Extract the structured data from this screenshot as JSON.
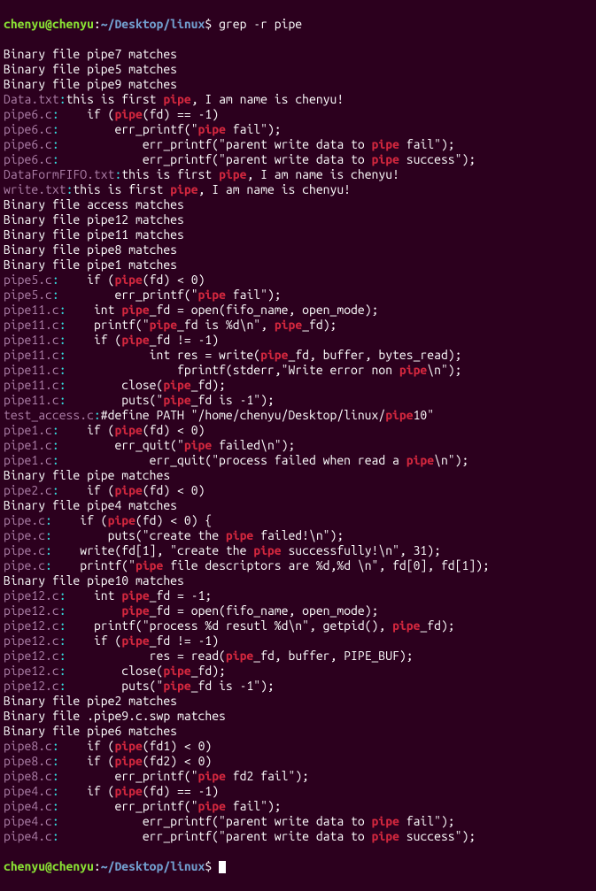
{
  "prompt": {
    "user": "chenyu@chenyu",
    "colon": ":",
    "path": "~/Desktop/linux",
    "dollar": "$ ",
    "command": "grep -r pipe"
  },
  "lines": [
    [
      {
        "t": "txt",
        "v": "Binary file pipe7 matches"
      }
    ],
    [
      {
        "t": "txt",
        "v": "Binary file pipe5 matches"
      }
    ],
    [
      {
        "t": "txt",
        "v": "Binary file pipe9 matches"
      }
    ],
    [
      {
        "t": "file",
        "v": "Data.txt"
      },
      {
        "t": "colon",
        "v": ":"
      },
      {
        "t": "txt",
        "v": "this is first "
      },
      {
        "t": "match",
        "v": "pipe"
      },
      {
        "t": "txt",
        "v": ", I am name is chenyu!"
      }
    ],
    [
      {
        "t": "file",
        "v": "pipe6.c"
      },
      {
        "t": "colon",
        "v": ":"
      },
      {
        "t": "txt",
        "v": "    if ("
      },
      {
        "t": "match",
        "v": "pipe"
      },
      {
        "t": "txt",
        "v": "(fd) == -1)"
      }
    ],
    [
      {
        "t": "file",
        "v": "pipe6.c"
      },
      {
        "t": "colon",
        "v": ":"
      },
      {
        "t": "txt",
        "v": "        err_printf(\""
      },
      {
        "t": "match",
        "v": "pipe"
      },
      {
        "t": "txt",
        "v": " fail\");"
      }
    ],
    [
      {
        "t": "file",
        "v": "pipe6.c"
      },
      {
        "t": "colon",
        "v": ":"
      },
      {
        "t": "txt",
        "v": "            err_printf(\"parent write data to "
      },
      {
        "t": "match",
        "v": "pipe"
      },
      {
        "t": "txt",
        "v": " fail\");"
      }
    ],
    [
      {
        "t": "file",
        "v": "pipe6.c"
      },
      {
        "t": "colon",
        "v": ":"
      },
      {
        "t": "txt",
        "v": "            err_printf(\"parent write data to "
      },
      {
        "t": "match",
        "v": "pipe"
      },
      {
        "t": "txt",
        "v": " success\");"
      }
    ],
    [
      {
        "t": "file",
        "v": "DataFormFIFO.txt"
      },
      {
        "t": "colon",
        "v": ":"
      },
      {
        "t": "txt",
        "v": "this is first "
      },
      {
        "t": "match",
        "v": "pipe"
      },
      {
        "t": "txt",
        "v": ", I am name is chenyu!"
      }
    ],
    [
      {
        "t": "file",
        "v": "write.txt"
      },
      {
        "t": "colon",
        "v": ":"
      },
      {
        "t": "txt",
        "v": "this is first "
      },
      {
        "t": "match",
        "v": "pipe"
      },
      {
        "t": "txt",
        "v": ", I am name is chenyu!"
      }
    ],
    [
      {
        "t": "txt",
        "v": "Binary file access matches"
      }
    ],
    [
      {
        "t": "txt",
        "v": "Binary file pipe12 matches"
      }
    ],
    [
      {
        "t": "txt",
        "v": "Binary file pipe11 matches"
      }
    ],
    [
      {
        "t": "txt",
        "v": "Binary file pipe8 matches"
      }
    ],
    [
      {
        "t": "txt",
        "v": "Binary file pipe1 matches"
      }
    ],
    [
      {
        "t": "file",
        "v": "pipe5.c"
      },
      {
        "t": "colon",
        "v": ":"
      },
      {
        "t": "txt",
        "v": "    if ("
      },
      {
        "t": "match",
        "v": "pipe"
      },
      {
        "t": "txt",
        "v": "(fd) < 0)"
      }
    ],
    [
      {
        "t": "file",
        "v": "pipe5.c"
      },
      {
        "t": "colon",
        "v": ":"
      },
      {
        "t": "txt",
        "v": "        err_printf(\""
      },
      {
        "t": "match",
        "v": "pipe"
      },
      {
        "t": "txt",
        "v": " fail\");"
      }
    ],
    [
      {
        "t": "file",
        "v": "pipe11.c"
      },
      {
        "t": "colon",
        "v": ":"
      },
      {
        "t": "txt",
        "v": "    int "
      },
      {
        "t": "match",
        "v": "pipe"
      },
      {
        "t": "txt",
        "v": "_fd = open(fifo_name, open_mode);"
      }
    ],
    [
      {
        "t": "file",
        "v": "pipe11.c"
      },
      {
        "t": "colon",
        "v": ":"
      },
      {
        "t": "txt",
        "v": "    printf(\""
      },
      {
        "t": "match",
        "v": "pipe"
      },
      {
        "t": "txt",
        "v": "_fd is %d\\n\", "
      },
      {
        "t": "match",
        "v": "pipe"
      },
      {
        "t": "txt",
        "v": "_fd);"
      }
    ],
    [
      {
        "t": "file",
        "v": "pipe11.c"
      },
      {
        "t": "colon",
        "v": ":"
      },
      {
        "t": "txt",
        "v": "    if ("
      },
      {
        "t": "match",
        "v": "pipe"
      },
      {
        "t": "txt",
        "v": "_fd != -1)"
      }
    ],
    [
      {
        "t": "file",
        "v": "pipe11.c"
      },
      {
        "t": "colon",
        "v": ":"
      },
      {
        "t": "txt",
        "v": "            int res = write("
      },
      {
        "t": "match",
        "v": "pipe"
      },
      {
        "t": "txt",
        "v": "_fd, buffer, bytes_read);"
      }
    ],
    [
      {
        "t": "file",
        "v": "pipe11.c"
      },
      {
        "t": "colon",
        "v": ":"
      },
      {
        "t": "txt",
        "v": "                fprintf(stderr,\"Write error non "
      },
      {
        "t": "match",
        "v": "pipe"
      },
      {
        "t": "txt",
        "v": "\\n\");"
      }
    ],
    [
      {
        "t": "file",
        "v": "pipe11.c"
      },
      {
        "t": "colon",
        "v": ":"
      },
      {
        "t": "txt",
        "v": "        close("
      },
      {
        "t": "match",
        "v": "pipe"
      },
      {
        "t": "txt",
        "v": "_fd);"
      }
    ],
    [
      {
        "t": "file",
        "v": "pipe11.c"
      },
      {
        "t": "colon",
        "v": ":"
      },
      {
        "t": "txt",
        "v": "        puts(\""
      },
      {
        "t": "match",
        "v": "pipe"
      },
      {
        "t": "txt",
        "v": "_fd is -1\");"
      }
    ],
    [
      {
        "t": "file",
        "v": "test_access.c"
      },
      {
        "t": "colon",
        "v": ":"
      },
      {
        "t": "txt",
        "v": "#define PATH \"/home/chenyu/Desktop/linux/"
      },
      {
        "t": "match",
        "v": "pipe"
      },
      {
        "t": "txt",
        "v": "10\""
      }
    ],
    [
      {
        "t": "file",
        "v": "pipe1.c"
      },
      {
        "t": "colon",
        "v": ":"
      },
      {
        "t": "txt",
        "v": "    if ("
      },
      {
        "t": "match",
        "v": "pipe"
      },
      {
        "t": "txt",
        "v": "(fd) < 0)"
      }
    ],
    [
      {
        "t": "file",
        "v": "pipe1.c"
      },
      {
        "t": "colon",
        "v": ":"
      },
      {
        "t": "txt",
        "v": "        err_quit(\""
      },
      {
        "t": "match",
        "v": "pipe"
      },
      {
        "t": "txt",
        "v": " failed\\n\");"
      }
    ],
    [
      {
        "t": "file",
        "v": "pipe1.c"
      },
      {
        "t": "colon",
        "v": ":"
      },
      {
        "t": "txt",
        "v": "             err_quit(\"process failed when read a "
      },
      {
        "t": "match",
        "v": "pipe"
      },
      {
        "t": "txt",
        "v": "\\n\");"
      }
    ],
    [
      {
        "t": "txt",
        "v": "Binary file pipe matches"
      }
    ],
    [
      {
        "t": "file",
        "v": "pipe2.c"
      },
      {
        "t": "colon",
        "v": ":"
      },
      {
        "t": "txt",
        "v": "    if ("
      },
      {
        "t": "match",
        "v": "pipe"
      },
      {
        "t": "txt",
        "v": "(fd) < 0)"
      }
    ],
    [
      {
        "t": "txt",
        "v": "Binary file pipe4 matches"
      }
    ],
    [
      {
        "t": "file",
        "v": "pipe.c"
      },
      {
        "t": "colon",
        "v": ":"
      },
      {
        "t": "txt",
        "v": "    if ("
      },
      {
        "t": "match",
        "v": "pipe"
      },
      {
        "t": "txt",
        "v": "(fd) < 0) {"
      }
    ],
    [
      {
        "t": "file",
        "v": "pipe.c"
      },
      {
        "t": "colon",
        "v": ":"
      },
      {
        "t": "txt",
        "v": "        puts(\"create the "
      },
      {
        "t": "match",
        "v": "pipe"
      },
      {
        "t": "txt",
        "v": " failed!\\n\");"
      }
    ],
    [
      {
        "t": "file",
        "v": "pipe.c"
      },
      {
        "t": "colon",
        "v": ":"
      },
      {
        "t": "txt",
        "v": "    write(fd[1], \"create the "
      },
      {
        "t": "match",
        "v": "pipe"
      },
      {
        "t": "txt",
        "v": " successfully!\\n\", 31);"
      }
    ],
    [
      {
        "t": "file",
        "v": "pipe.c"
      },
      {
        "t": "colon",
        "v": ":"
      },
      {
        "t": "txt",
        "v": "    printf(\""
      },
      {
        "t": "match",
        "v": "pipe"
      },
      {
        "t": "txt",
        "v": " file descriptors are %d,%d \\n\", fd[0], fd[1]);"
      }
    ],
    [
      {
        "t": "txt",
        "v": "Binary file pipe10 matches"
      }
    ],
    [
      {
        "t": "file",
        "v": "pipe12.c"
      },
      {
        "t": "colon",
        "v": ":"
      },
      {
        "t": "txt",
        "v": "    int "
      },
      {
        "t": "match",
        "v": "pipe"
      },
      {
        "t": "txt",
        "v": "_fd = -1;"
      }
    ],
    [
      {
        "t": "file",
        "v": "pipe12.c"
      },
      {
        "t": "colon",
        "v": ":"
      },
      {
        "t": "txt",
        "v": "        "
      },
      {
        "t": "match",
        "v": "pipe"
      },
      {
        "t": "txt",
        "v": "_fd = open(fifo_name, open_mode);"
      }
    ],
    [
      {
        "t": "file",
        "v": "pipe12.c"
      },
      {
        "t": "colon",
        "v": ":"
      },
      {
        "t": "txt",
        "v": "    printf(\"process %d resutl %d\\n\", getpid(), "
      },
      {
        "t": "match",
        "v": "pipe"
      },
      {
        "t": "txt",
        "v": "_fd);"
      }
    ],
    [
      {
        "t": "file",
        "v": "pipe12.c"
      },
      {
        "t": "colon",
        "v": ":"
      },
      {
        "t": "txt",
        "v": "    if ("
      },
      {
        "t": "match",
        "v": "pipe"
      },
      {
        "t": "txt",
        "v": "_fd != -1)"
      }
    ],
    [
      {
        "t": "file",
        "v": "pipe12.c"
      },
      {
        "t": "colon",
        "v": ":"
      },
      {
        "t": "txt",
        "v": "            res = read("
      },
      {
        "t": "match",
        "v": "pipe"
      },
      {
        "t": "txt",
        "v": "_fd, buffer, PIPE_BUF);"
      }
    ],
    [
      {
        "t": "file",
        "v": "pipe12.c"
      },
      {
        "t": "colon",
        "v": ":"
      },
      {
        "t": "txt",
        "v": "        close("
      },
      {
        "t": "match",
        "v": "pipe"
      },
      {
        "t": "txt",
        "v": "_fd);"
      }
    ],
    [
      {
        "t": "file",
        "v": "pipe12.c"
      },
      {
        "t": "colon",
        "v": ":"
      },
      {
        "t": "txt",
        "v": "        puts(\""
      },
      {
        "t": "match",
        "v": "pipe"
      },
      {
        "t": "txt",
        "v": "_fd is -1\");"
      }
    ],
    [
      {
        "t": "txt",
        "v": "Binary file pipe2 matches"
      }
    ],
    [
      {
        "t": "txt",
        "v": "Binary file .pipe9.c.swp matches"
      }
    ],
    [
      {
        "t": "txt",
        "v": "Binary file pipe6 matches"
      }
    ],
    [
      {
        "t": "file",
        "v": "pipe8.c"
      },
      {
        "t": "colon",
        "v": ":"
      },
      {
        "t": "txt",
        "v": "    if ("
      },
      {
        "t": "match",
        "v": "pipe"
      },
      {
        "t": "txt",
        "v": "(fd1) < 0)"
      }
    ],
    [
      {
        "t": "file",
        "v": "pipe8.c"
      },
      {
        "t": "colon",
        "v": ":"
      },
      {
        "t": "txt",
        "v": "    if ("
      },
      {
        "t": "match",
        "v": "pipe"
      },
      {
        "t": "txt",
        "v": "(fd2) < 0)"
      }
    ],
    [
      {
        "t": "file",
        "v": "pipe8.c"
      },
      {
        "t": "colon",
        "v": ":"
      },
      {
        "t": "txt",
        "v": "        err_printf(\""
      },
      {
        "t": "match",
        "v": "pipe"
      },
      {
        "t": "txt",
        "v": " fd2 fail\");"
      }
    ],
    [
      {
        "t": "file",
        "v": "pipe4.c"
      },
      {
        "t": "colon",
        "v": ":"
      },
      {
        "t": "txt",
        "v": "    if ("
      },
      {
        "t": "match",
        "v": "pipe"
      },
      {
        "t": "txt",
        "v": "(fd) == -1)"
      }
    ],
    [
      {
        "t": "file",
        "v": "pipe4.c"
      },
      {
        "t": "colon",
        "v": ":"
      },
      {
        "t": "txt",
        "v": "        err_printf(\""
      },
      {
        "t": "match",
        "v": "pipe"
      },
      {
        "t": "txt",
        "v": " fail\");"
      }
    ],
    [
      {
        "t": "file",
        "v": "pipe4.c"
      },
      {
        "t": "colon",
        "v": ":"
      },
      {
        "t": "txt",
        "v": "            err_printf(\"parent write data to "
      },
      {
        "t": "match",
        "v": "pipe"
      },
      {
        "t": "txt",
        "v": " fail\");"
      }
    ],
    [
      {
        "t": "file",
        "v": "pipe4.c"
      },
      {
        "t": "colon",
        "v": ":"
      },
      {
        "t": "txt",
        "v": "            err_printf(\"parent write data to "
      },
      {
        "t": "match",
        "v": "pipe"
      },
      {
        "t": "txt",
        "v": " success\");"
      }
    ]
  ]
}
